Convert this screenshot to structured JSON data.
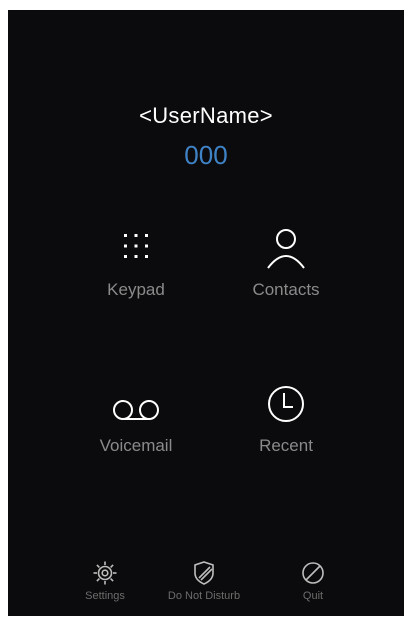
{
  "user": {
    "name": "<UserName>",
    "extension": "000"
  },
  "tiles": {
    "keypad": {
      "label": "Keypad",
      "icon": "keypad-icon"
    },
    "contacts": {
      "label": "Contacts",
      "icon": "person-icon"
    },
    "voicemail": {
      "label": "Voicemail",
      "icon": "voicemail-icon"
    },
    "recent": {
      "label": "Recent",
      "icon": "clock-icon"
    }
  },
  "bottom_bar": {
    "settings": {
      "label": "Settings",
      "icon": "gear-icon"
    },
    "do_not_disturb": {
      "label": "Do Not Disturb",
      "icon": "shield-icon"
    },
    "quit": {
      "label": "Quit",
      "icon": "no-entry-icon"
    }
  },
  "colors": {
    "background": "#0b0b0d",
    "accent": "#3f83c6",
    "text_primary": "#ffffff",
    "text_secondary": "#8a8a8a"
  }
}
